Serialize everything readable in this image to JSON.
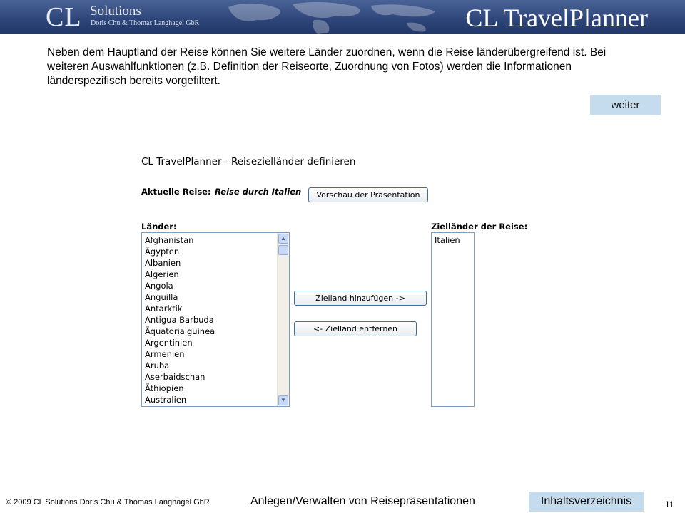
{
  "header": {
    "logo_cl": "CL",
    "logo_solutions": "Solutions",
    "logo_sub": "Doris Chu & Thomas Langhagel GbR",
    "app_title": "CL TravelPlanner"
  },
  "intro": {
    "text": "Neben dem Hauptland der Reise können Sie weitere Länder zuordnen, wenn die Reise länderübergreifend ist. Bei weiteren Auswahlfunktionen (z.B. Definition der Reiseorte, Zuordnung von Fotos) werden die Informationen länderspezifisch bereits vorgefiltert.",
    "next_label": "weiter"
  },
  "window": {
    "title": "CL TravelPlanner - Reisezielländer definieren",
    "current_label": "Aktuelle Reise:",
    "current_value": "Reise durch Italien",
    "preview_button": "Vorschau der Präsentation",
    "countries_label": "Länder:",
    "destinations_label": "Zielländer der Reise:",
    "add_button": "Zielland hinzufügen ->",
    "remove_button": "<- Zielland entfernen",
    "countries": [
      "Afghanistan",
      "Ägypten",
      "Albanien",
      "Algerien",
      "Angola",
      "Anguilla",
      "Antarktik",
      "Antigua Barbuda",
      "Äquatorialguinea",
      "Argentinien",
      "Armenien",
      "Aruba",
      "Aserbaidschan",
      "Äthiopien",
      "Australien"
    ],
    "destinations": [
      "Italien"
    ]
  },
  "footer": {
    "copyright": "© 2009 CL Solutions Doris Chu & Thomas Langhagel GbR",
    "section": "Anlegen/Verwalten von Reisepräsentationen",
    "toc": "Inhaltsverzeichnis",
    "page": "11"
  },
  "colors": {
    "header": "#2d4478",
    "button_accent": "#c5dcef",
    "button_border": "#3a6ea5"
  }
}
